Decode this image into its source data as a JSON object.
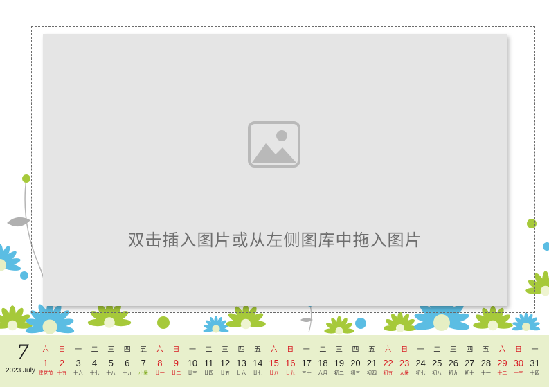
{
  "placeholder": {
    "text": "双击插入图片或从左侧图库中拖入图片",
    "icon": "image-placeholder-icon"
  },
  "calendar": {
    "month_number": "7",
    "month_label": "2023 July",
    "weekend_color": "#d71920",
    "solar_term_color": "#7aa616",
    "weekdays": [
      "六",
      "日",
      "一",
      "二",
      "三",
      "四",
      "五",
      "六",
      "日",
      "一",
      "二",
      "三",
      "四",
      "五",
      "六",
      "日",
      "一",
      "二",
      "三",
      "四",
      "五",
      "六",
      "日",
      "一",
      "二",
      "三",
      "四",
      "五",
      "六",
      "日",
      "一"
    ],
    "days": [
      "1",
      "2",
      "3",
      "4",
      "5",
      "6",
      "7",
      "8",
      "9",
      "10",
      "11",
      "12",
      "13",
      "14",
      "15",
      "16",
      "17",
      "18",
      "19",
      "20",
      "21",
      "22",
      "23",
      "24",
      "25",
      "26",
      "27",
      "28",
      "29",
      "30",
      "31"
    ],
    "lunar": [
      "建党节",
      "十五",
      "十六",
      "十七",
      "十八",
      "十九",
      "小暑",
      "廿一",
      "廿二",
      "廿三",
      "廿四",
      "廿五",
      "廿六",
      "廿七",
      "廿八",
      "廿九",
      "三十",
      "六月",
      "初二",
      "初三",
      "初四",
      "初五",
      "大暑",
      "初七",
      "初八",
      "初九",
      "初十",
      "十一",
      "十二",
      "十三",
      "十四"
    ],
    "lunar_style": [
      "red",
      "red",
      "",
      "",
      "",
      "",
      "grn",
      "red",
      "red",
      "",
      "",
      "",
      "",
      "",
      "red",
      "red",
      "",
      "",
      "",
      "",
      "",
      "red",
      "red",
      "",
      "",
      "",
      "",
      "",
      "red",
      "red",
      ""
    ]
  },
  "colors": {
    "background": "#ffffff",
    "photo_fill": "#e5e5e5",
    "calendar_band": "#e8f0cc",
    "flower_blue": "#5bbde3",
    "flower_green": "#a6c93a"
  }
}
